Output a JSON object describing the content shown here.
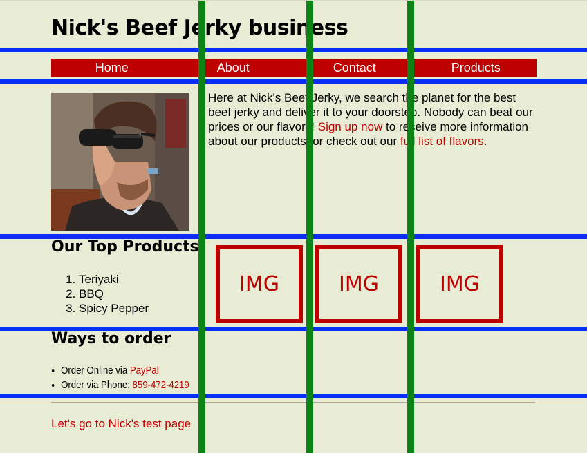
{
  "site": {
    "title": "Nick's Beef Jerky business"
  },
  "nav": {
    "items": [
      {
        "label": "Home"
      },
      {
        "label": "About"
      },
      {
        "label": "Contact"
      },
      {
        "label": "Products"
      }
    ]
  },
  "intro": {
    "text_before": "Here at Nick's Beef Jerky, we search the planet for the best beef jerky and deliver it to your doorstep. Nobody can beat our prices or our flavors! ",
    "signup_link": "Sign up now",
    "text_middle": " to receive more information about our products, or check out our ",
    "flavors_link": "full list of flavors",
    "text_after": "."
  },
  "top_products": {
    "heading": "Our Top Products",
    "items": [
      "Teriyaki",
      "BBQ",
      "Spicy Pepper"
    ],
    "image_placeholders": [
      "IMG",
      "IMG",
      "IMG"
    ]
  },
  "ways_to_order": {
    "heading": "Ways to order",
    "online_text": "Order Online via ",
    "online_link": "PayPal",
    "phone_text": "Order via Phone: ",
    "phone_link": "859-472-4219"
  },
  "footer": {
    "link": "Let's go to Nick's test page"
  },
  "colors": {
    "background": "#e9ecd5",
    "accent_red": "#bd0000",
    "guide_blue": "#0a2ef5",
    "guide_green": "#0d8315"
  }
}
